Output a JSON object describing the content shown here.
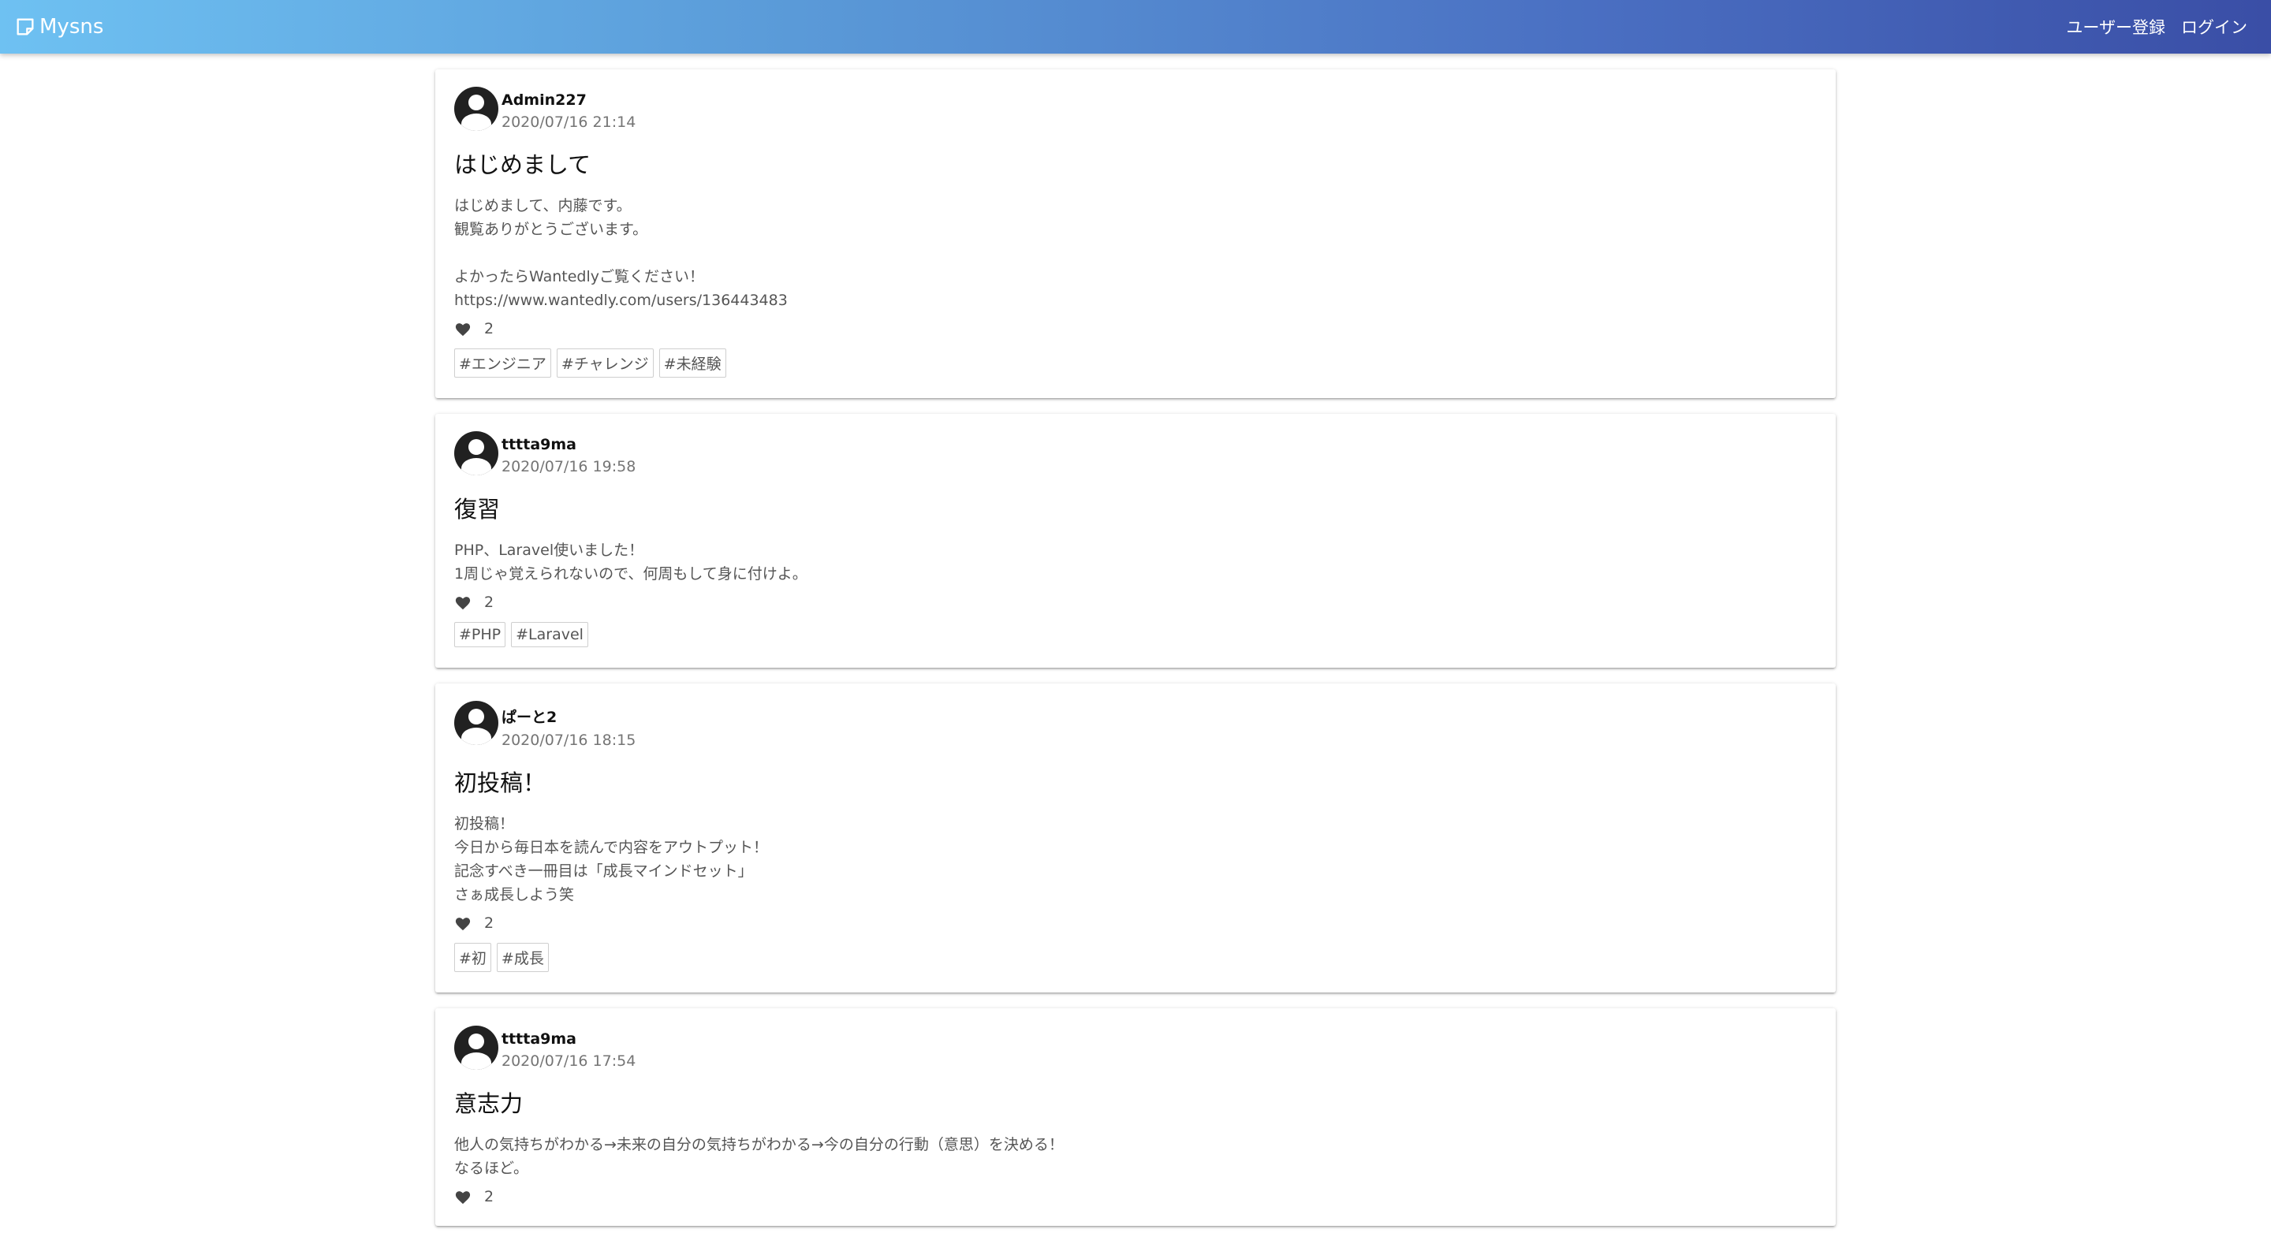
{
  "nav": {
    "brand": "Mysns",
    "links": [
      "ユーザー登録",
      "ログイン"
    ]
  },
  "posts": [
    {
      "author": "Admin227",
      "date": "2020/07/16 21:14",
      "title": "はじめまして",
      "body": "はじめまして、内藤です。\n観覧ありがとうございます。\n\nよかったらWantedlyご覧ください！\nhttps://www.wantedly.com/users/136443483",
      "likes": "2",
      "tags": [
        "#エンジニア",
        "#チャレンジ",
        "#未経験"
      ]
    },
    {
      "author": "tttta9ma",
      "date": "2020/07/16 19:58",
      "title": "復習",
      "body": "PHP、Laravel使いました！\n1周じゃ覚えられないので、何周もして身に付けよ。",
      "likes": "2",
      "tags": [
        "#PHP",
        "#Laravel"
      ]
    },
    {
      "author": "ぱーと2",
      "date": "2020/07/16 18:15",
      "title": "初投稿！",
      "body": "初投稿！\n今日から毎日本を読んで内容をアウトプット！\n記念すべき一冊目は「成長マインドセット」\nさぁ成長しよう笑",
      "likes": "2",
      "tags": [
        "#初",
        "#成長"
      ]
    },
    {
      "author": "tttta9ma",
      "date": "2020/07/16 17:54",
      "title": "意志力",
      "body": "他人の気持ちがわかる→未来の自分の気持ちがわかる→今の自分の行動（意思）を決める！\nなるほど。",
      "likes": "2",
      "tags": []
    }
  ]
}
